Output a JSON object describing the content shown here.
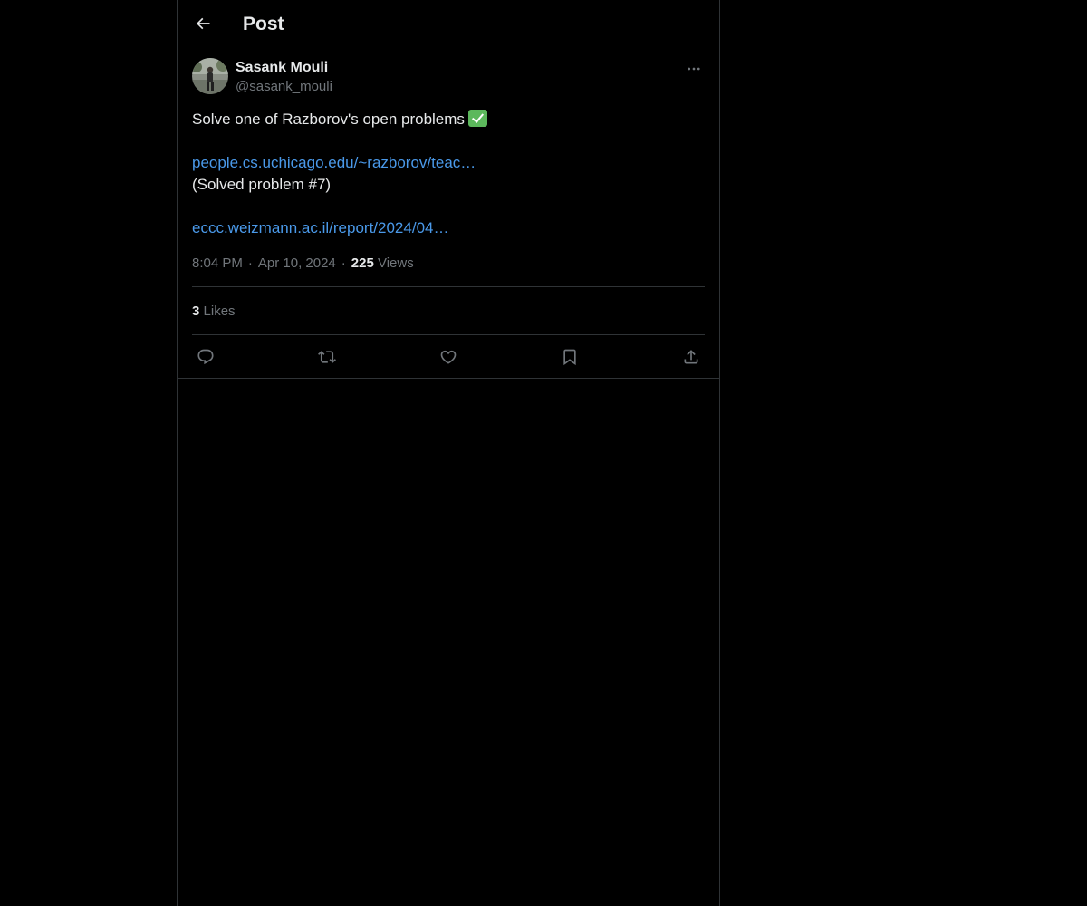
{
  "header": {
    "title": "Post",
    "back_icon": "arrow-left-icon"
  },
  "post": {
    "author": {
      "name": "Sasank Mouli",
      "handle": "@sasank_mouli"
    },
    "text_line1": "Solve one of Razborov's open problems",
    "emoji": "check-mark-button-icon",
    "link1": "people.cs.uchicago.edu/~razborov/teac…",
    "text_line2": "(Solved problem #7)",
    "link2": "eccc.weizmann.ac.il/report/2024/04…",
    "time": "8:04 PM",
    "separator": "·",
    "date": "Apr 10, 2024",
    "views_count": "225",
    "views_label": "Views",
    "likes_count": "3",
    "likes_label": "Likes"
  },
  "actions": {
    "reply": "reply-icon",
    "repost": "repost-icon",
    "like": "heart-icon",
    "bookmark": "bookmark-icon",
    "share": "share-icon"
  },
  "colors": {
    "background": "#000000",
    "text": "#e7e9ea",
    "secondary": "#71767b",
    "link": "#4a99e9",
    "border": "#2f3336"
  }
}
